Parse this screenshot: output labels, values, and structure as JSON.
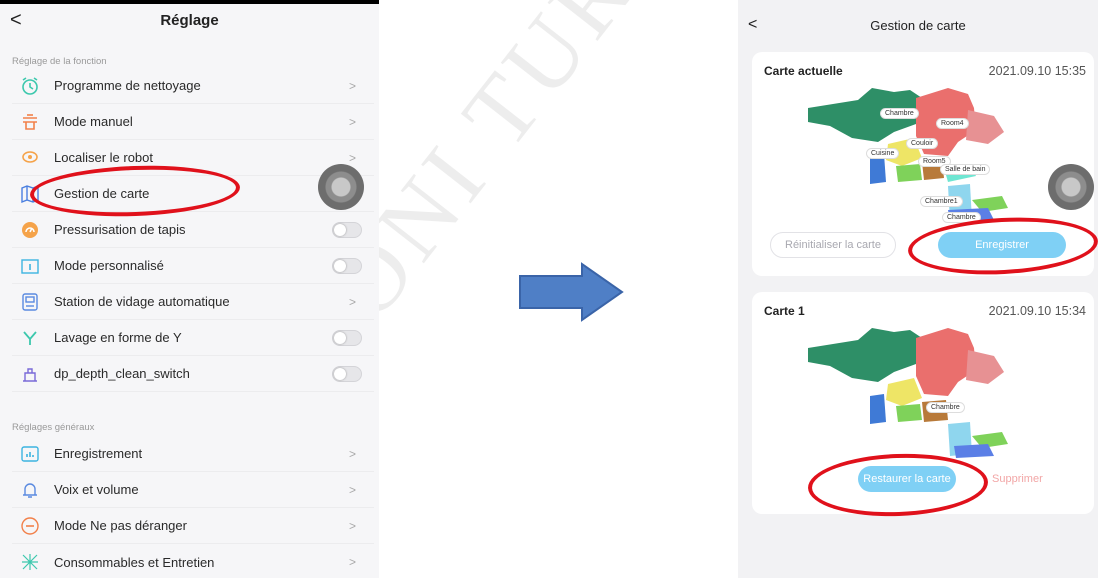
{
  "left": {
    "back_glyph": "<",
    "title": "Réglage",
    "section1": "Réglage de la fonction",
    "section2": "Réglages généraux",
    "chevron": ">",
    "items": [
      {
        "label": "Programme de nettoyage",
        "icon": "clock-icon",
        "control": "chevron"
      },
      {
        "label": "Mode manuel",
        "icon": "manual-mode-icon",
        "control": "chevron"
      },
      {
        "label": "Localiser le robot",
        "icon": "location-pin-icon",
        "control": "chevron"
      },
      {
        "label": "Gestion de carte",
        "icon": "map-icon",
        "control": "chevron"
      },
      {
        "label": "Pressurisation de tapis",
        "icon": "carpet-boost-icon",
        "control": "toggle",
        "on": false
      },
      {
        "label": "Mode personnalisé",
        "icon": "custom-mode-icon",
        "control": "toggle",
        "on": false
      },
      {
        "label": "Station de vidage automatique",
        "icon": "dock-station-icon",
        "control": "chevron"
      },
      {
        "label": "Lavage en forme de Y",
        "icon": "y-path-icon",
        "control": "toggle",
        "on": false
      },
      {
        "label": "dp_depth_clean_switch",
        "icon": "depth-clean-icon",
        "control": "toggle",
        "on": false
      },
      {
        "label": "Enregistrement",
        "icon": "record-icon",
        "control": "chevron"
      },
      {
        "label": "Voix et volume",
        "icon": "bell-icon",
        "control": "chevron"
      },
      {
        "label": "Mode Ne pas déranger",
        "icon": "do-not-disturb-icon",
        "control": "chevron"
      },
      {
        "label": "Consommables et Entretien",
        "icon": "consumables-icon",
        "control": "chevron"
      }
    ]
  },
  "right": {
    "back_glyph": "<",
    "title": "Gestion de carte",
    "card1": {
      "name": "Carte actuelle",
      "date": "2021.09.10 15:35",
      "reset_label": "Réinitialiser la carte",
      "save_label": "Enregistrer",
      "rooms": [
        "Chambre",
        "Room4",
        "Couloir",
        "Cuisine",
        "Room5",
        "Salle de bain",
        "Chambre1",
        "Chambre"
      ]
    },
    "card2": {
      "name": "Carte 1",
      "date": "2021.09.10 15:34",
      "restore_label": "Restaurer la carte",
      "delete_label": "Supprimer",
      "rooms": [
        "Chambre"
      ]
    }
  },
  "watermark": "HONI TURE",
  "colors": {
    "accent": "#7fd0f5",
    "highlight": "#e0111b",
    "arrow": "#4f7fc6"
  }
}
